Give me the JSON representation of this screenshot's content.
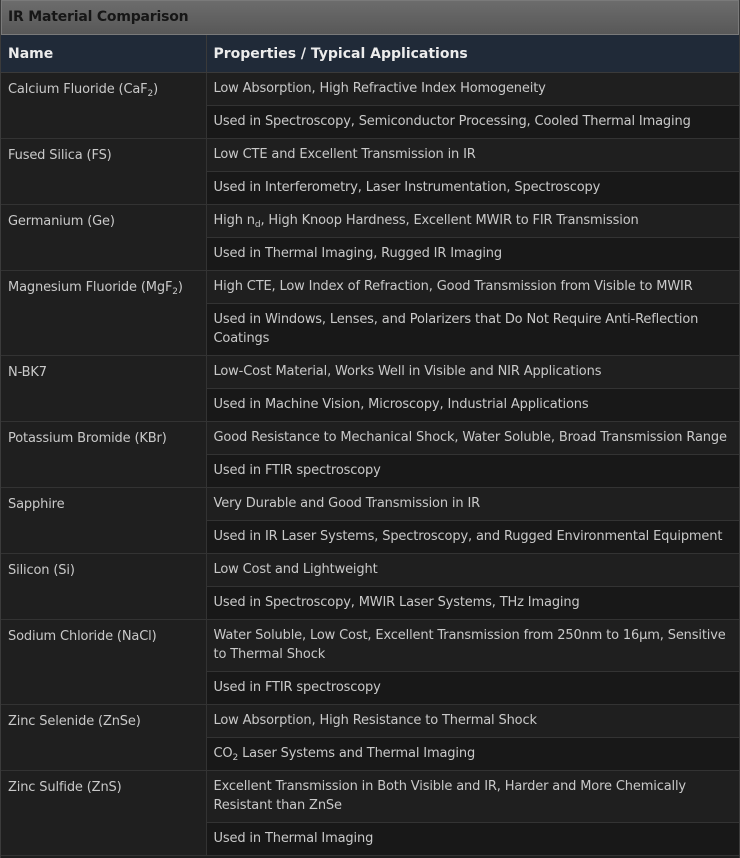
{
  "title": "IR Material Comparison",
  "headers": {
    "name": "Name",
    "properties": "Properties / Typical Applications"
  },
  "materials": [
    {
      "name_pre": "Calcium Fluoride (CaF",
      "name_sub": "2",
      "name_post": ")",
      "prop_pre": "Low Absorption, High Refractive Index Homogeneity",
      "prop_sub": "",
      "prop_post": "",
      "app_pre": "Used in Spectroscopy, Semiconductor Processing, Cooled Thermal Imaging",
      "app_sub": "",
      "app_post": ""
    },
    {
      "name_pre": "Fused Silica (FS)",
      "name_sub": "",
      "name_post": "",
      "prop_pre": "Low CTE and Excellent Transmission in IR",
      "prop_sub": "",
      "prop_post": "",
      "app_pre": "Used in Interferometry, Laser Instrumentation, Spectroscopy",
      "app_sub": "",
      "app_post": ""
    },
    {
      "name_pre": "Germanium (Ge)",
      "name_sub": "",
      "name_post": "",
      "prop_pre": "High n",
      "prop_sub": "d",
      "prop_post": ", High Knoop Hardness, Excellent MWIR to FIR Transmission",
      "app_pre": "Used in Thermal Imaging, Rugged IR Imaging",
      "app_sub": "",
      "app_post": ""
    },
    {
      "name_pre": "Magnesium Fluoride (MgF",
      "name_sub": "2",
      "name_post": ")",
      "prop_pre": "High CTE, Low Index of Refraction, Good Transmission from Visible to MWIR",
      "prop_sub": "",
      "prop_post": "",
      "app_pre": "Used in Windows, Lenses, and Polarizers that Do Not Require Anti-Reflection Coatings",
      "app_sub": "",
      "app_post": ""
    },
    {
      "name_pre": "N-BK7",
      "name_sub": "",
      "name_post": "",
      "prop_pre": "Low-Cost Material, Works Well in Visible and NIR Applications",
      "prop_sub": "",
      "prop_post": "",
      "app_pre": "Used in Machine Vision, Microscopy, Industrial Applications",
      "app_sub": "",
      "app_post": ""
    },
    {
      "name_pre": "Potassium Bromide (KBr)",
      "name_sub": "",
      "name_post": "",
      "prop_pre": "Good Resistance to Mechanical Shock, Water Soluble, Broad Transmission Range",
      "prop_sub": "",
      "prop_post": "",
      "app_pre": "Used in FTIR spectroscopy",
      "app_sub": "",
      "app_post": ""
    },
    {
      "name_pre": "Sapphire",
      "name_sub": "",
      "name_post": "",
      "prop_pre": "Very Durable and Good Transmission in IR",
      "prop_sub": "",
      "prop_post": "",
      "app_pre": "Used in IR Laser Systems, Spectroscopy, and Rugged Environmental Equipment",
      "app_sub": "",
      "app_post": ""
    },
    {
      "name_pre": "Silicon (Si)",
      "name_sub": "",
      "name_post": "",
      "prop_pre": "Low Cost and Lightweight",
      "prop_sub": "",
      "prop_post": "",
      "app_pre": "Used in Spectroscopy, MWIR Laser Systems, THz Imaging",
      "app_sub": "",
      "app_post": ""
    },
    {
      "name_pre": "Sodium Chloride (NaCl)",
      "name_sub": "",
      "name_post": "",
      "prop_pre": "Water Soluble, Low Cost, Excellent Transmission from 250nm to 16μm, Sensitive to Thermal Shock",
      "prop_sub": "",
      "prop_post": "",
      "app_pre": "Used in FTIR spectroscopy",
      "app_sub": "",
      "app_post": ""
    },
    {
      "name_pre": "Zinc Selenide (ZnSe)",
      "name_sub": "",
      "name_post": "",
      "prop_pre": "Low Absorption, High Resistance to Thermal Shock",
      "prop_sub": "",
      "prop_post": "",
      "app_pre": "CO",
      "app_sub": "2",
      "app_post": " Laser Systems and Thermal Imaging"
    },
    {
      "name_pre": "Zinc Sulfide (ZnS)",
      "name_sub": "",
      "name_post": "",
      "prop_pre": "Excellent Transmission in Both Visible and IR, Harder and More Chemically Resistant than ZnSe",
      "prop_sub": "",
      "prop_post": "",
      "app_pre": "Used in Thermal Imaging",
      "app_sub": "",
      "app_post": ""
    }
  ]
}
